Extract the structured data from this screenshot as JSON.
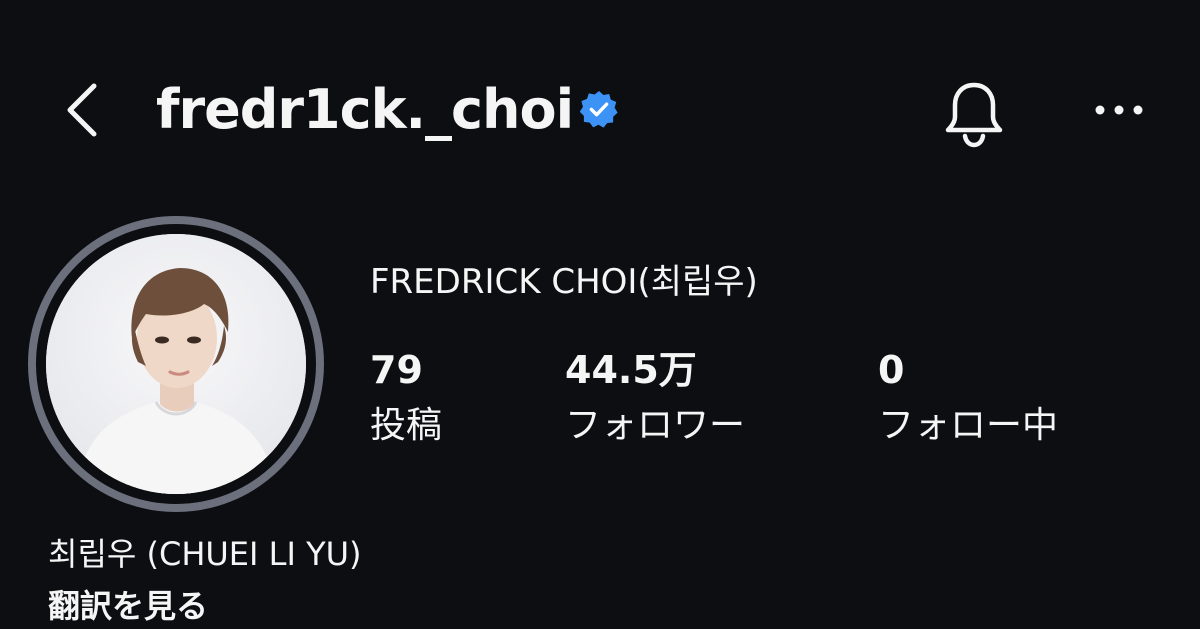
{
  "header": {
    "back_icon": "chevron-left-icon",
    "username": "fredr1ck._choi",
    "verified_icon": "verified-badge-icon",
    "verified_color": "#3d93f5",
    "bell_icon": "bell-icon",
    "more_icon": "more-horizontal-icon"
  },
  "profile": {
    "avatar": "profile-photo",
    "display_name": "FREDRICK CHOI(최립우)",
    "stats": [
      {
        "value": "79",
        "label": "投稿"
      },
      {
        "value": "44.5万",
        "label": "フォロワー"
      },
      {
        "value": "0",
        "label": "フォロー中"
      }
    ]
  },
  "bio": {
    "name_line": "최립우 (CHUEI LI YU)",
    "see_translation": "翻訳を見る"
  },
  "colors": {
    "background": "#0c0e12",
    "text": "#f5f5f5",
    "avatar_ring": "#6b707c"
  }
}
